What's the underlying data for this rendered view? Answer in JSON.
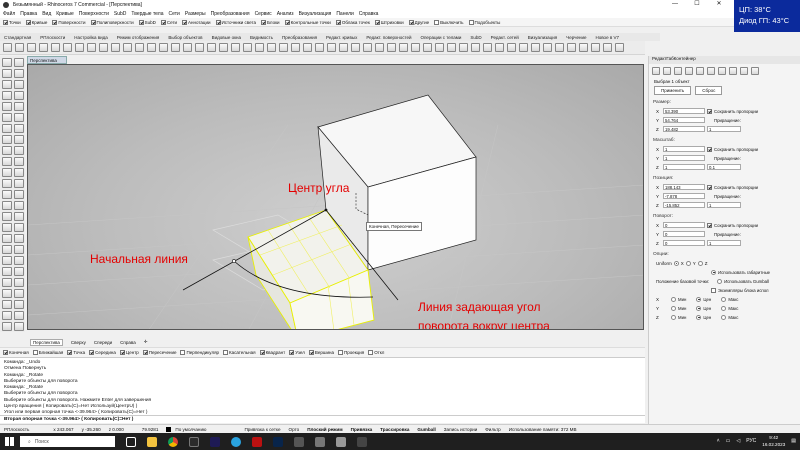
{
  "window": {
    "title": "Безымянный - Rhinoceros 7 Commercial - [Перспектива]"
  },
  "hud": {
    "cpu": "ЦП: 38°C",
    "gpu": "Диод ГП: 43°C"
  },
  "menu": [
    "Файл",
    "Правка",
    "Вид",
    "Кривые",
    "Поверхности",
    "SubD",
    "Твердые тела",
    "Сети",
    "Размеры",
    "Преобразования",
    "Сервис",
    "Анализ",
    "Визуализация",
    "Панели",
    "Справка"
  ],
  "filters": [
    {
      "label": "Точки",
      "on": true
    },
    {
      "label": "Кривые",
      "on": true
    },
    {
      "label": "Поверхности",
      "on": true
    },
    {
      "label": "Полиповерхности",
      "on": true
    },
    {
      "label": "SubD",
      "on": true
    },
    {
      "label": "Сети",
      "on": true
    },
    {
      "label": "Аннотации",
      "on": true
    },
    {
      "label": "Источники света",
      "on": true
    },
    {
      "label": "Блоки",
      "on": true
    },
    {
      "label": "Контрольные точки",
      "on": true
    },
    {
      "label": "Облака точек",
      "on": true
    },
    {
      "label": "Штриховки",
      "on": true
    },
    {
      "label": "Другие",
      "on": true
    },
    {
      "label": "Выключить",
      "on": false
    },
    {
      "label": "Подобъекты",
      "on": false
    }
  ],
  "toolbar_tabs": [
    "Стандартная",
    "РПлоскости",
    "Настройка вида",
    "Режим отображения",
    "Выбор объектов",
    "Видовые окна",
    "Видимость",
    "Преобразования",
    "Редакт. кривых",
    "Редакт. поверхностей",
    "Операции с телами",
    "SubD",
    "Редакт. сетей",
    "Визуализация",
    "Черчение",
    "Новое в V7"
  ],
  "viewport": {
    "tab_label": "Перспектива",
    "annotations": {
      "center": "Центр угла",
      "start_line": "Начальная линия",
      "angle_line_1": "Линия задающая угол",
      "angle_line_2": "поворота вокруг центра"
    },
    "tooltip": "Конечная, Пересечение"
  },
  "bottom_tabs": [
    "Перспектива",
    "Сверху",
    "Спереди",
    "Справа"
  ],
  "osnaps": [
    {
      "label": "Конечная",
      "on": true
    },
    {
      "label": "Ближайшая",
      "on": false
    },
    {
      "label": "Точка",
      "on": true
    },
    {
      "label": "Середина",
      "on": true
    },
    {
      "label": "Центр",
      "on": true
    },
    {
      "label": "Пересечение",
      "on": true
    },
    {
      "label": "Перпендикуляр",
      "on": false
    },
    {
      "label": "Касательная",
      "on": false
    },
    {
      "label": "Квадрант",
      "on": true
    },
    {
      "label": "Узел",
      "on": true
    },
    {
      "label": "Вершина",
      "on": true
    },
    {
      "label": "Проекция",
      "on": false
    },
    {
      "label": "Откл",
      "on": false
    }
  ],
  "command_history": [
    "Команда: _Undo",
    "Отмена Повернуть",
    "Команда: _Rotate",
    "Выберите объекты для поворота",
    "Команда: _Rotate",
    "Выберите объекты для поворота",
    "Выберите объекты для поворота. Нажмите Enter для завершения",
    "Центр вращения ( Копировать(С)=Нет  Используй(ЦентрU) )",
    "Угол или первая опорная точка <-39.964> ( Копировать(С)=Нет )"
  ],
  "command_prompt": "Вторая опорная точка <-39.964> ( Копировать(С)=Нет )",
  "status": {
    "cplane": "РПлоскость",
    "x": "x 243.067",
    "y": "y -35.260",
    "z": "z 0.000",
    "dist": "79.9281",
    "layer": "По умолчанию",
    "grid_snap": "Привязка к сетке",
    "ortho": "Орто",
    "planar": "Плоский режим",
    "osnap": "Привязка",
    "smarttrack": "Трассировка",
    "gumball": "Gumball",
    "history": "Запись истории",
    "filter": "Фильтр",
    "memory": "Использование памяти: 372 MB"
  },
  "taskbar": {
    "search": "Поиск",
    "lang": "РУС",
    "time": "9:42",
    "date": "16.02.2023"
  },
  "panel": {
    "title": "РедактГабКонтейнер",
    "selected": "Выбран 1 объект",
    "apply": "Применить",
    "reset": "Сброс",
    "keep_ratio": "Сохранить пропорции",
    "increment": "Приращение:",
    "size": {
      "title": "Размер:",
      "x": "53.390",
      "y": "54.764",
      "z": "19.482",
      "ix": "1",
      "iy": "1",
      "iz": "1"
    },
    "scale": {
      "title": "Масштаб:",
      "x": "1",
      "y": "1",
      "z": "1",
      "ix": "1",
      "iy": "1",
      "iz": "0.1"
    },
    "position": {
      "title": "Позиция:",
      "x": "188.143",
      "y": "-7.878",
      "z": "-15.852",
      "ix": "1",
      "iy": "1",
      "iz": "1"
    },
    "rotation": {
      "title": "Поворот:",
      "x": "0",
      "y": "0",
      "z": "0",
      "ix": "1",
      "iy": "1",
      "iz": "1"
    },
    "options": {
      "title": "Опции:",
      "uniform": "Uniform",
      "ux": "X",
      "uy": "Y",
      "uz": "Z",
      "use_bbox": "Использовать габаритные",
      "base_point": "Положение базовой точки:",
      "use_gumball": "Использовать Gumball",
      "block_instances": "Экземпляры блока испол",
      "rows": [
        {
          "axis": "X",
          "min": "Мин",
          "cen": "Цен",
          "max": "Макс"
        },
        {
          "axis": "Y",
          "min": "Мин",
          "cen": "Цен",
          "max": "Макс"
        },
        {
          "axis": "Z",
          "min": "Мин",
          "cen": "Цен",
          "max": "Макс"
        }
      ]
    }
  },
  "colors": {
    "annotation": "#e40000",
    "hud_bg": "#0b2a9c",
    "highlight": "#e8f000"
  }
}
